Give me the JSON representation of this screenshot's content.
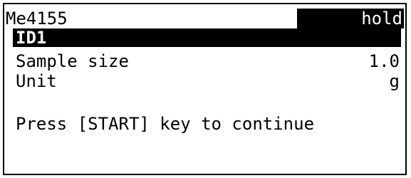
{
  "header": {
    "method": "Me4155",
    "status": "hold"
  },
  "selected_item": "ID1",
  "fields": [
    {
      "label": "Sample size",
      "value": "1.0"
    },
    {
      "label": "Unit",
      "value": "g"
    }
  ],
  "prompt": "Press [START] key to continue",
  "colors": {
    "foreground": "#000000",
    "background": "#ffffff"
  }
}
